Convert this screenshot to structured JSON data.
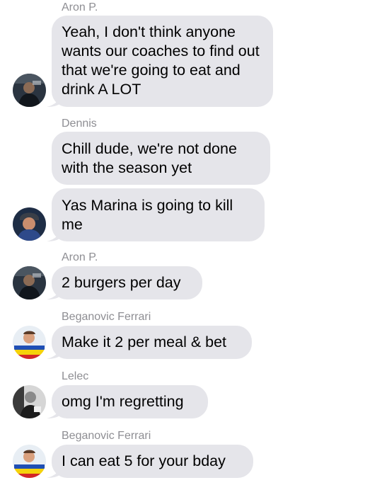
{
  "colors": {
    "bubble": "#e5e5ea",
    "sender": "#8e8e93",
    "text": "#000000",
    "background": "#ffffff"
  },
  "messages": [
    {
      "sender": "Aron P.",
      "text": "Yeah, I don't think anyone wants our coaches to find out that we're going to eat and drink A LOT",
      "avatar": "aron-avatar"
    },
    {
      "sender": "Dennis",
      "text": "Chill dude, we're not done with the season yet",
      "avatar": ""
    },
    {
      "sender": "",
      "text": "Yas Marina is going to kill me",
      "avatar": "dennis-avatar"
    },
    {
      "sender": "Aron P.",
      "text": "2 burgers per day",
      "avatar": "aron-avatar"
    },
    {
      "sender": "Beganovic Ferrari",
      "text": "Make it 2 per meal & bet",
      "avatar": "beganovic-avatar"
    },
    {
      "sender": "Lelec",
      "text": "omg I'm regretting",
      "avatar": "lelec-avatar"
    },
    {
      "sender": "Beganovic Ferrari",
      "text": "I can eat 5 for your bday",
      "avatar": "beganovic-avatar"
    }
  ]
}
